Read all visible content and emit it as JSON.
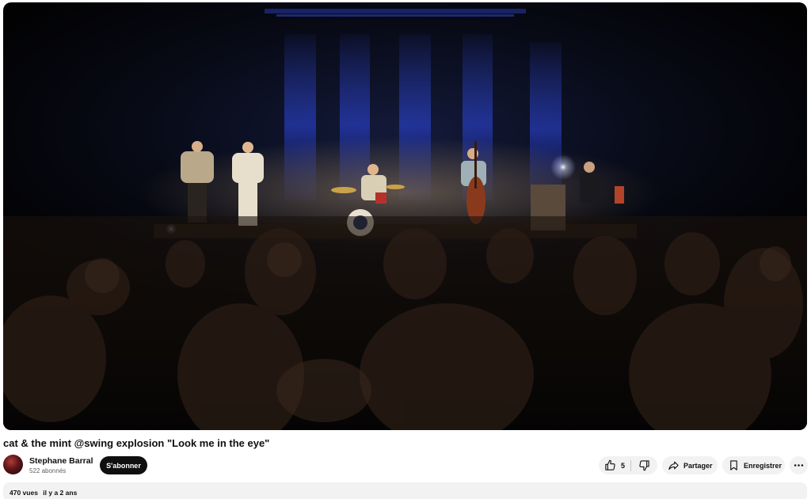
{
  "video": {
    "title": "cat & the mint @swing explosion \"Look me in the eye\"",
    "scene": "live-concert-stage"
  },
  "channel": {
    "name": "Stephane Barral",
    "subscribers": "522 abonnés",
    "subscribe_label": "S'abonner"
  },
  "actions": {
    "like_count": "5",
    "share_label": "Partager",
    "save_label": "Enregistrer"
  },
  "description": {
    "views": "470 vues",
    "date": "il y a 2 ans"
  },
  "colors": {
    "subscribe_bg": "#0f0f0f",
    "pill_bg": "#f2f2f2",
    "stage_light": "#2a3fbf"
  },
  "icons": [
    "thumb-up-icon",
    "thumb-down-icon",
    "share-arrow-icon",
    "bookmark-icon",
    "more-horizontal-icon"
  ]
}
